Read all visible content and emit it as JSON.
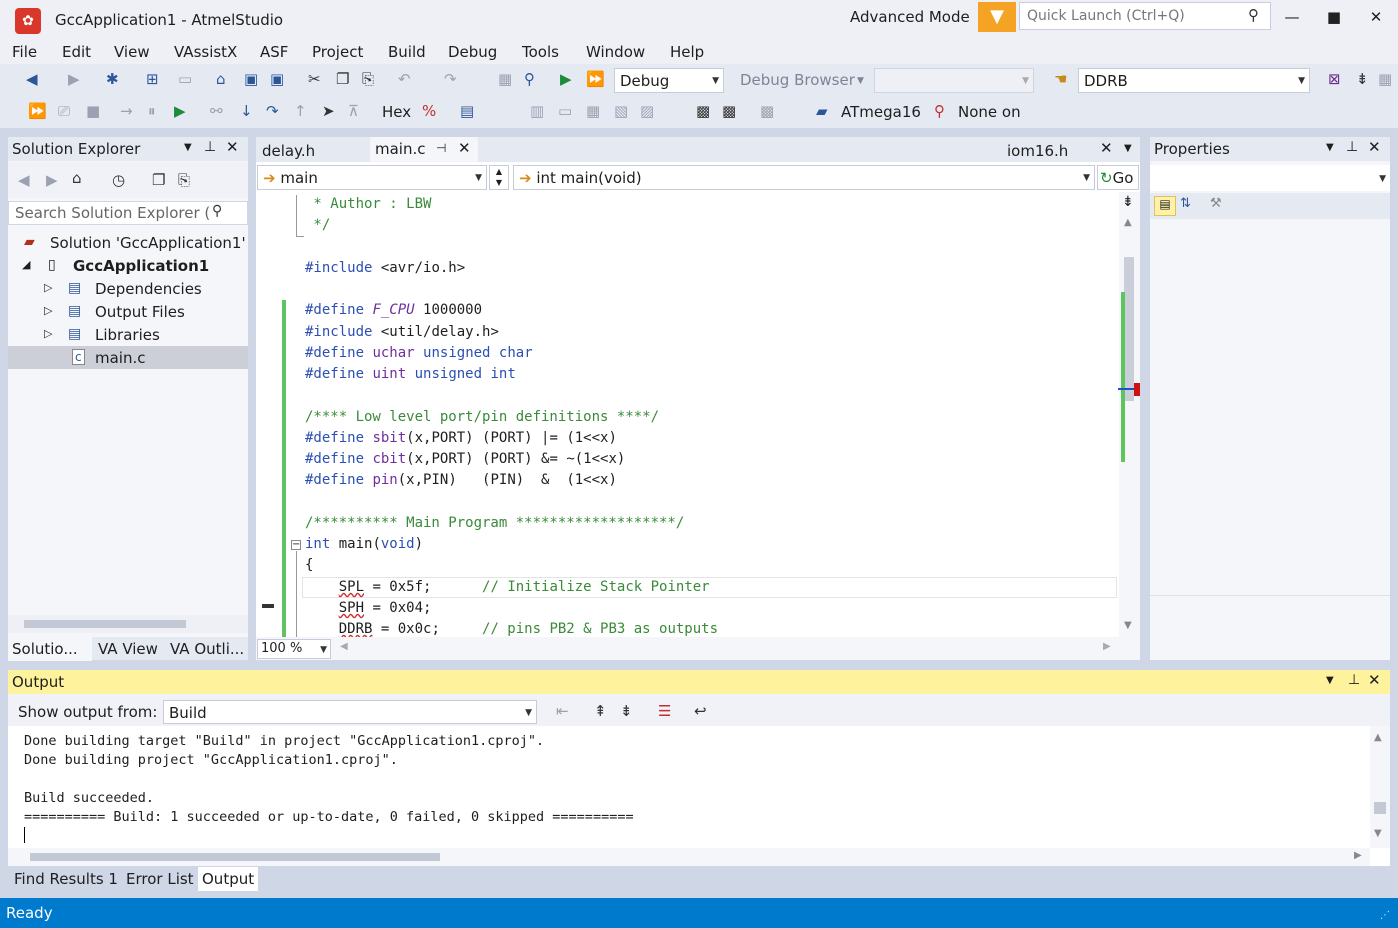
{
  "title": {
    "app_name": "GccApplication1 - AtmelStudio",
    "mode": "Advanced Mode",
    "quick_launch_placeholder": "Quick Launch (Ctrl+Q)"
  },
  "menu": [
    "File",
    "Edit",
    "View",
    "VAssistX",
    "ASF",
    "Project",
    "Build",
    "Debug",
    "Tools",
    "Window",
    "Help"
  ],
  "toolbar": {
    "config": "Debug",
    "debug_browser": "Debug Browser",
    "symbol": "DDRB",
    "hex_label": "Hex",
    "device": "ATmega16",
    "tool": "None on"
  },
  "solution_explorer": {
    "title": "Solution Explorer",
    "search_placeholder": "Search Solution Explorer (",
    "items": [
      {
        "label": "Solution 'GccApplication1'"
      },
      {
        "label": "GccApplication1"
      },
      {
        "label": "Dependencies"
      },
      {
        "label": "Output Files"
      },
      {
        "label": "Libraries"
      },
      {
        "label": "main.c"
      }
    ],
    "tabs": [
      "Solutio...",
      "VA View",
      "VA Outli..."
    ]
  },
  "editor": {
    "tabs": [
      "delay.h",
      "main.c",
      "iom16.h"
    ],
    "scope_combo": "main",
    "function_combo": "int main(void)",
    "go_label": "Go",
    "zoom": "100 %",
    "lines": [
      " * Author : LBW",
      " */",
      "",
      "#include <avr/io.h>",
      "",
      "#define F_CPU 1000000",
      "#include <util/delay.h>",
      "#define uchar unsigned char",
      "#define uint unsigned int",
      "",
      "/**** Low level port/pin definitions ****/",
      "#define sbit(x,PORT) (PORT) |= (1<<x)",
      "#define cbit(x,PORT) (PORT) &= ~(1<<x)",
      "#define pin(x,PIN)   (PIN)  &  (1<<x)",
      "",
      "/********** Main Program *******************/",
      "int main(void)",
      "{",
      "    SPL = 0x5f;      // Initialize Stack Pointer",
      "    SPH = 0x04;",
      "    DDRB = 0x0c;     // pins PB2 & PB3 as outputs"
    ]
  },
  "properties": {
    "title": "Properties"
  },
  "output": {
    "title": "Output",
    "show_from_label": "Show output from:",
    "source": "Build",
    "lines": [
      "Done building target \"Build\" in project \"GccApplication1.cproj\".",
      "Done building project \"GccApplication1.cproj\".",
      "",
      "Build succeeded.",
      "========== Build: 1 succeeded or up-to-date, 0 failed, 0 skipped =========="
    ],
    "tabs": [
      "Find Results 1",
      "Error List",
      "Output"
    ]
  },
  "status": {
    "text": "Ready"
  }
}
